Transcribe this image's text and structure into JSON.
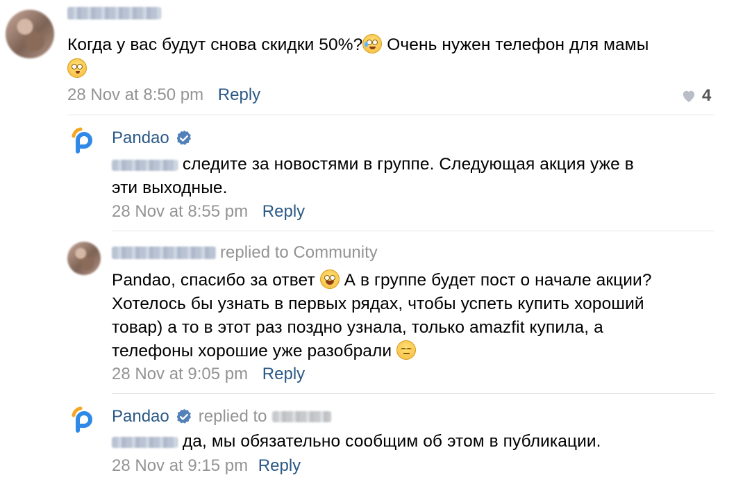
{
  "comments": [
    {
      "text": "Когда у вас будут снова скидки 50%?",
      "text_after_emoji": " Очень нужен телефон для мамы",
      "time": "28 Nov at 8:50 pm",
      "reply_label": "Reply",
      "like_count": "4"
    },
    {
      "author": "Pandao",
      "text": " следите за новостями в группе. Следующая акция уже в",
      "text_line2": "эти выходные.",
      "time": "28 Nov at 8:55 pm",
      "reply_label": "Reply"
    },
    {
      "replied_to": "replied to Community",
      "text_line1": "Pandao, спасибо за ответ",
      "text_line1b": " А в группе будет пост о начале акции?",
      "text_line2": "Хотелось бы узнать в первых рядах, чтобы успеть купить хороший",
      "text_line3": "товар) а то в этот раз поздно узнала, только amazfit купила, а",
      "text_line4": "телефоны хорошие уже разобрали",
      "time": "28 Nov at 9:05 pm",
      "reply_label": "Reply"
    },
    {
      "author": "Pandao",
      "replied_to": "replied to",
      "text": " да, мы обязательно сообщим об этом в публикации.",
      "time": "28 Nov at 9:15 pm",
      "reply_label": "Reply"
    }
  ],
  "colors": {
    "link": "#2a5885",
    "meta": "#939393",
    "divider": "#e2e4e8",
    "verified": "#5181b8"
  },
  "icons": [
    "heart-icon",
    "verified-icon",
    "pandao-logo-icon",
    "emoji-icon"
  ]
}
